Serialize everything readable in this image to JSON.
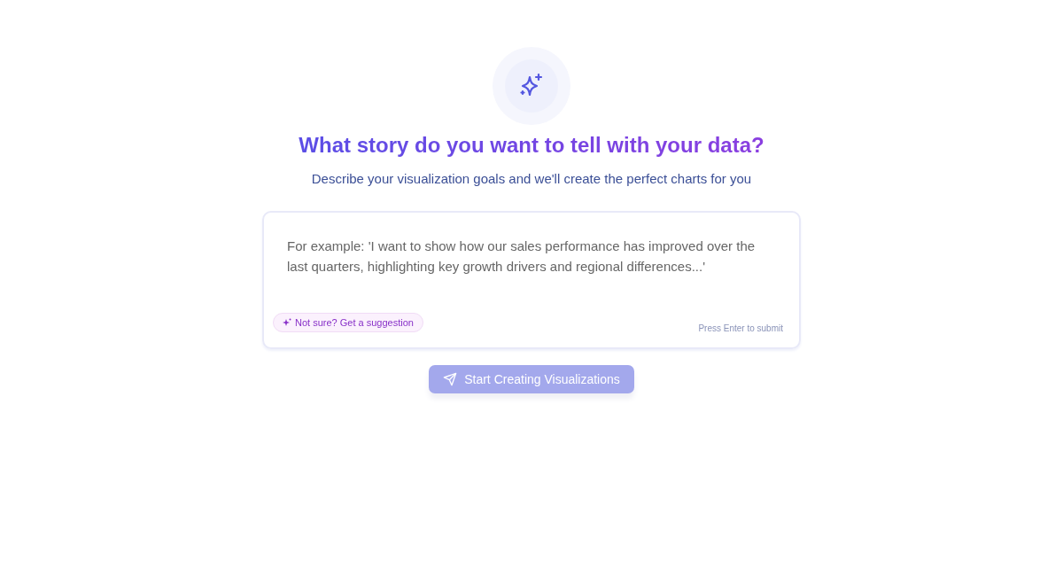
{
  "heading": "What story do you want to tell with your data?",
  "subheading": "Describe your visualization goals and we'll create the perfect charts for you",
  "story_input": {
    "placeholder": "For example: 'I want to show how our sales performance has improved over the last quarters, highlighting key growth drivers and regional differences...'"
  },
  "suggestion_button": {
    "label": "Not sure? Get a suggestion"
  },
  "hint": "Press Enter to submit",
  "submit_button": {
    "label": "Start Creating Visualizations",
    "disabled": true
  }
}
